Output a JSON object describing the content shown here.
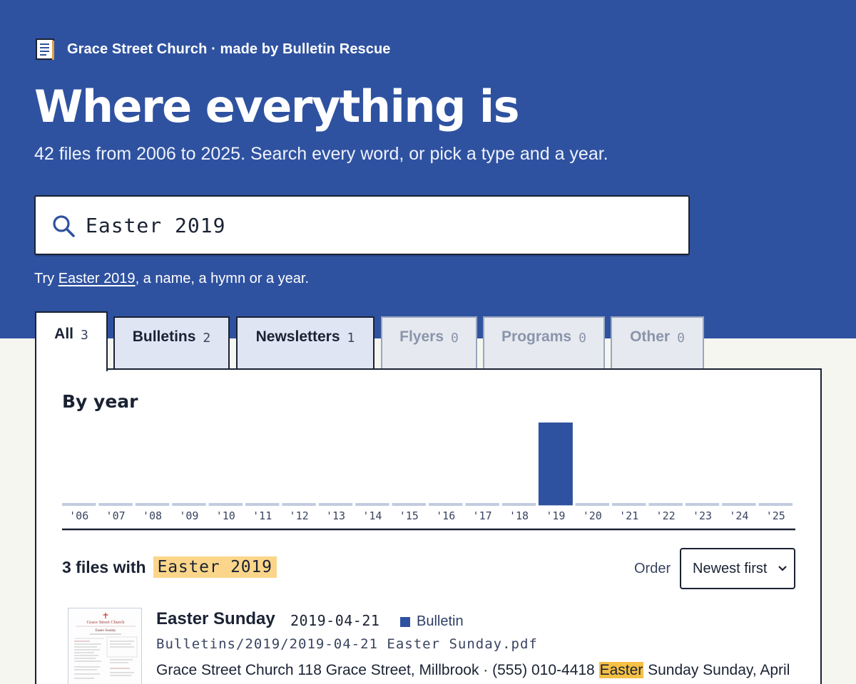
{
  "brand": {
    "text": "Grace Street Church · made by Bulletin Rescue",
    "icon": "document-icon"
  },
  "header": {
    "title": "Where everything is",
    "subtitle": "42 files from 2006 to 2025. Search every word, or pick a type and a year."
  },
  "search": {
    "value": "Easter 2019",
    "icon": "search-icon"
  },
  "hint": {
    "prefix": "Try ",
    "link": "Easter 2019",
    "suffix": ", a name, a hymn or a year."
  },
  "tabs": [
    {
      "label": "All",
      "count": "3",
      "active": true
    },
    {
      "label": "Bulletins",
      "count": "2"
    },
    {
      "label": "Newsletters",
      "count": "1"
    },
    {
      "label": "Flyers",
      "count": "0",
      "disabled": true
    },
    {
      "label": "Programs",
      "count": "0",
      "disabled": true
    },
    {
      "label": "Other",
      "count": "0",
      "disabled": true
    }
  ],
  "by_year": {
    "title": "By year"
  },
  "chart_data": {
    "type": "bar",
    "categories": [
      "'06",
      "'07",
      "'08",
      "'09",
      "'10",
      "'11",
      "'12",
      "'13",
      "'14",
      "'15",
      "'16",
      "'17",
      "'18",
      "'19",
      "'20",
      "'21",
      "'22",
      "'23",
      "'24",
      "'25"
    ],
    "values": [
      0,
      0,
      0,
      0,
      0,
      0,
      0,
      0,
      0,
      0,
      0,
      0,
      0,
      3,
      0,
      0,
      0,
      0,
      0,
      0
    ],
    "title": "By year",
    "xlabel": "",
    "ylabel": "",
    "ylim": [
      0,
      3
    ],
    "grid": false,
    "colors": {
      "bar": "#2f52a0",
      "baseline": "#c2cbe0",
      "axis": "#1a2233"
    }
  },
  "results": {
    "count_label": "3 files with",
    "query": "Easter 2019",
    "order_label": "Order",
    "order_value": "Newest first",
    "items": [
      {
        "title": "Easter Sunday",
        "date": "2019-04-21",
        "type": "Bulletin",
        "path": "Bulletins/2019/2019-04-21 Easter Sunday.pdf",
        "snippet_before": "Grace Street Church 118 Grace Street, Millbrook · (555) 010-4418 ",
        "snippet_highlight": "Easter",
        "snippet_after": " Sunday Sunday, April",
        "thumb_church": "Grace Street Church",
        "thumb_title": "Easter Sunday"
      }
    ]
  },
  "colors": {
    "hero": "#2f52a0",
    "highlight": "#fbd68a",
    "snippet_highlight": "#f5c045",
    "bulletin": "#2f52a0"
  }
}
